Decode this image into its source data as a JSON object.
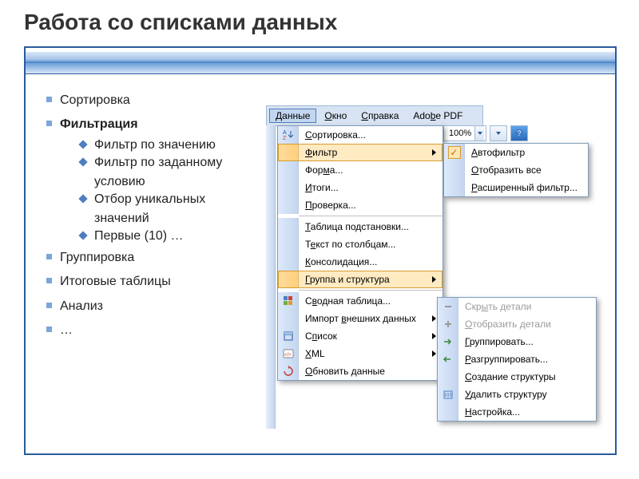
{
  "title": "Работа со списками данных",
  "bullets": {
    "sort": "Сортировка",
    "filter": "Фильтрация",
    "filter_sub": [
      "Фильтр по значению",
      "Фильтр по заданному условию",
      "Отбор уникальных значений",
      "Первые (10) …"
    ],
    "group": "Группировка",
    "pivot": "Итоговые таблицы",
    "analysis": "Анализ",
    "more": "…"
  },
  "menubar": [
    {
      "label": "Данные",
      "u": "Д",
      "active": true
    },
    {
      "label": "Окно",
      "u": "О"
    },
    {
      "label": "Справка",
      "u": "С"
    },
    {
      "label": "Adobe PDF",
      "u": "b"
    }
  ],
  "zoom": "100%",
  "dd1": [
    {
      "icon": "sort",
      "label": "Сортировка...",
      "u": "С"
    },
    {
      "icon": "",
      "label": "Фильтр",
      "u": "Ф",
      "arrow": true,
      "hi": true
    },
    {
      "icon": "",
      "label": "Форма...",
      "u": "м"
    },
    {
      "icon": "",
      "label": "Итоги...",
      "u": "И"
    },
    {
      "icon": "",
      "label": "Проверка...",
      "u": "П"
    },
    {
      "sep": true
    },
    {
      "icon": "",
      "label": "Таблица подстановки...",
      "u": "Т"
    },
    {
      "icon": "",
      "label": "Текст по столбцам...",
      "u": "е"
    },
    {
      "icon": "",
      "label": "Консолидация...",
      "u": "К"
    },
    {
      "icon": "",
      "label": "Группа и структура",
      "u": "Г",
      "arrow": true,
      "hi": true
    },
    {
      "sep": true
    },
    {
      "icon": "pivot",
      "label": "Сводная таблица...",
      "u": "в"
    },
    {
      "icon": "",
      "label": "Импорт внешних данных",
      "u": "в",
      "arrow": true
    },
    {
      "icon": "list",
      "label": "Список",
      "u": "п",
      "arrow": true
    },
    {
      "icon": "xml",
      "label": "XML",
      "u": "X",
      "arrow": true
    },
    {
      "icon": "refresh",
      "label": "Обновить данные",
      "u": "О"
    }
  ],
  "dd2": [
    {
      "icon": "check",
      "label": "Автофильтр",
      "u": "А"
    },
    {
      "icon": "",
      "label": "Отобразить все",
      "u": "О"
    },
    {
      "icon": "",
      "label": "Расширенный фильтр...",
      "u": "Р"
    }
  ],
  "dd3": [
    {
      "icon": "hide",
      "label": "Скрыть детали",
      "u": "ы",
      "dim": true
    },
    {
      "icon": "show",
      "label": "Отобразить детали",
      "u": "О",
      "dim": true
    },
    {
      "icon": "grp",
      "label": "Группировать...",
      "u": "Г"
    },
    {
      "icon": "ungrp",
      "label": "Разгруппировать...",
      "u": "Р"
    },
    {
      "icon": "",
      "label": "Создание структуры",
      "u": "С"
    },
    {
      "icon": "del",
      "label": "Удалить структуру",
      "u": "У"
    },
    {
      "icon": "",
      "label": "Настройка...",
      "u": "Н"
    }
  ]
}
